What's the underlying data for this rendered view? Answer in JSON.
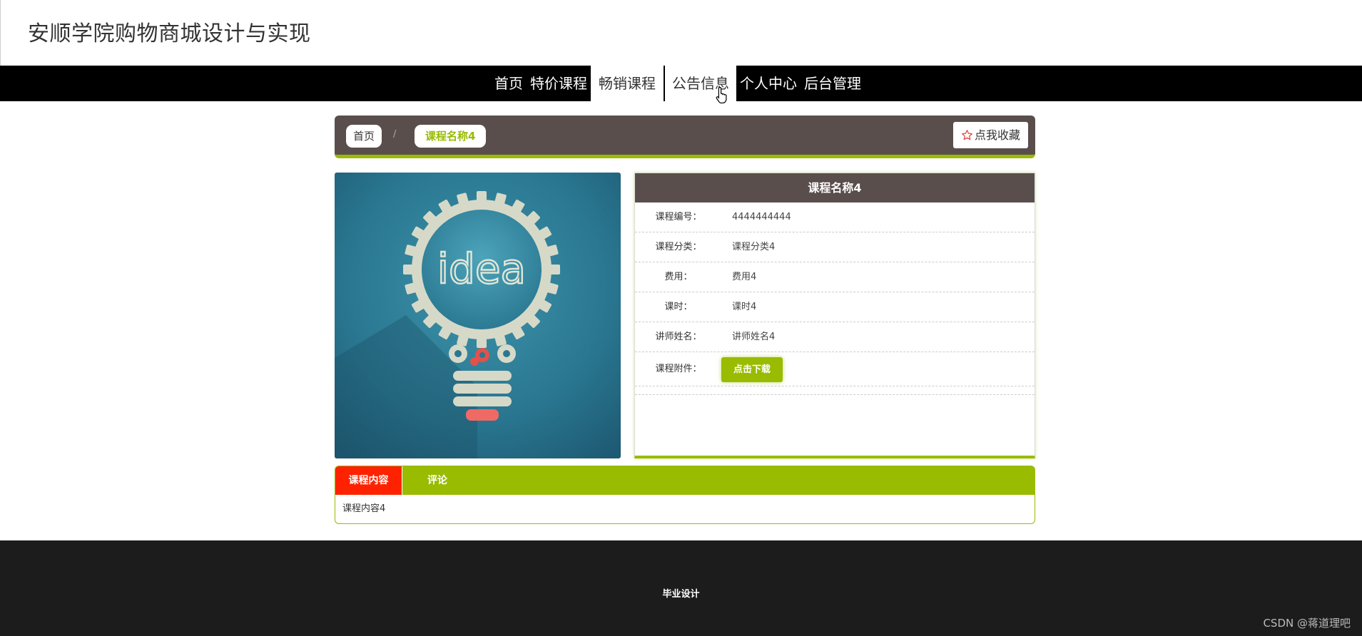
{
  "site": {
    "title": "安顺学院购物商城设计与实现"
  },
  "nav": {
    "items": [
      {
        "label": "首页"
      },
      {
        "label": "特价课程"
      },
      {
        "label": "畅销课程"
      },
      {
        "label": "公告信息"
      },
      {
        "label": "个人中心"
      },
      {
        "label": "后台管理"
      }
    ]
  },
  "breadcrumb": {
    "home": "首页",
    "separator": "/",
    "current": "课程名称4"
  },
  "favorite_button": {
    "label": "点我收藏",
    "icon": "star-outline-icon"
  },
  "course_image": {
    "text": "idea"
  },
  "details": {
    "title": "课程名称4",
    "rows": [
      {
        "label": "课程编号：",
        "value": "4444444444"
      },
      {
        "label": "课程分类：",
        "value": "课程分类4"
      },
      {
        "label": "费用：",
        "value": "费用4"
      },
      {
        "label": "课时：",
        "value": "课时4"
      },
      {
        "label": "讲师姓名：",
        "value": "讲师姓名4"
      }
    ],
    "attachment_label": "课程附件：",
    "download_button": "点击下载"
  },
  "tabs": {
    "items": [
      {
        "label": "课程内容"
      },
      {
        "label": "评论"
      }
    ],
    "content": "课程内容4"
  },
  "footer": {
    "text": "毕业设计"
  },
  "watermark": "CSDN @蒋道理吧",
  "colors": {
    "accent": "#99bb00",
    "header_dark": "#5a4e4d",
    "tab_active": "#ff2200",
    "nav_bg": "#000000",
    "footer_bg": "#1c1c1c"
  }
}
